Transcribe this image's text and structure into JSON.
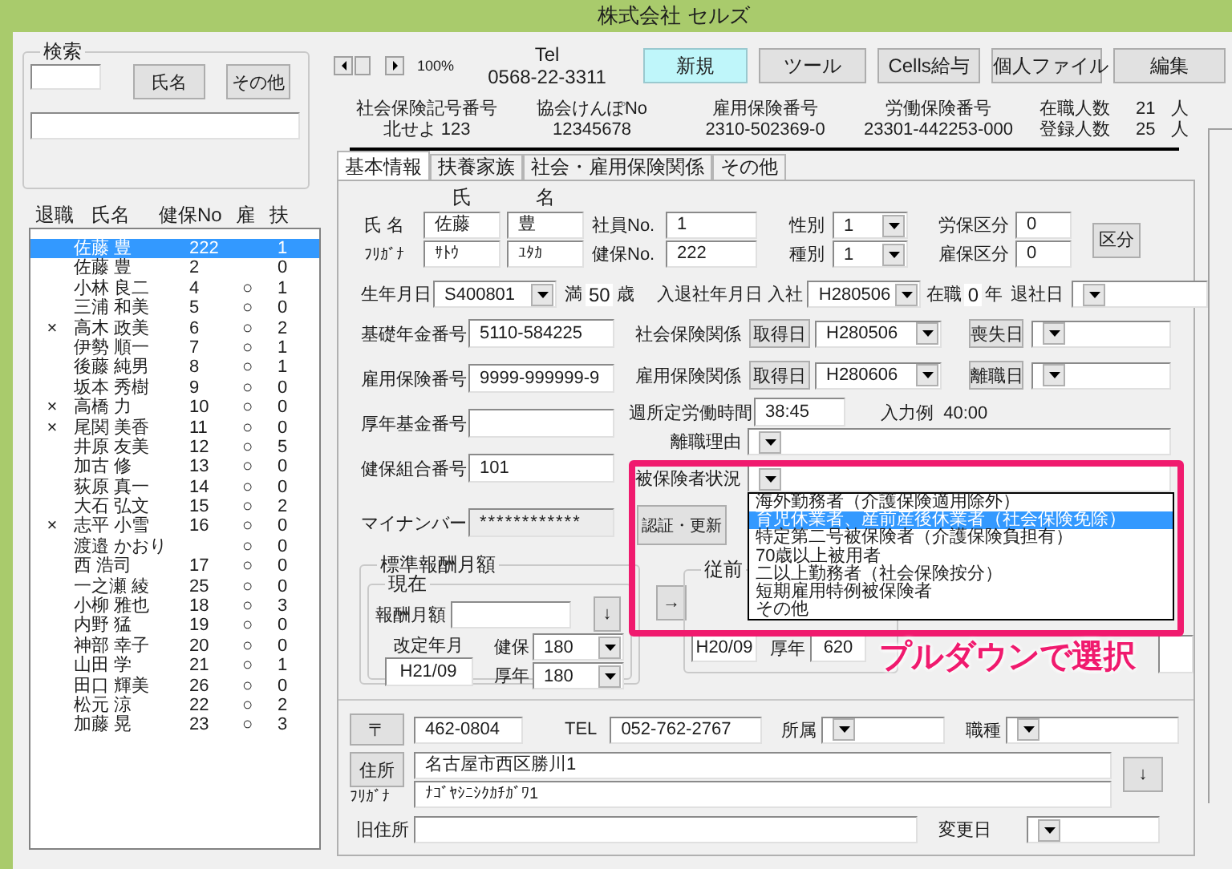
{
  "window": {
    "title": "株式会社 セルズ"
  },
  "search": {
    "title": "検索",
    "buttons": [
      "氏名",
      "その他"
    ]
  },
  "employee_list": {
    "columns": [
      "退職",
      "氏名",
      "健保No",
      "雇",
      "扶"
    ],
    "rows": [
      {
        "name": "佐藤 豊",
        "kenpo_no": "222",
        "dependents": "1",
        "selected": true
      },
      {
        "name": "佐藤 豊",
        "kenpo_no": "2",
        "dependents": "0",
        "selected": false
      },
      {
        "name": "小林 良二",
        "kenpo_no": "4",
        "employment": "○",
        "dependents": "1",
        "selected": false
      },
      {
        "name": "三浦 和美",
        "kenpo_no": "5",
        "employment": "○",
        "dependents": "0",
        "selected": false
      },
      {
        "retired": "×",
        "name": "高木 政美",
        "kenpo_no": "6",
        "employment": "○",
        "dependents": "2",
        "selected": false
      },
      {
        "name": "伊勢 順一",
        "kenpo_no": "7",
        "employment": "○",
        "dependents": "1",
        "selected": false
      },
      {
        "name": "後藤 純男",
        "kenpo_no": "8",
        "employment": "○",
        "dependents": "1",
        "selected": false
      },
      {
        "name": "坂本 秀樹",
        "kenpo_no": "9",
        "employment": "○",
        "dependents": "0",
        "selected": false
      },
      {
        "retired": "×",
        "name": "高橋 力",
        "kenpo_no": "10",
        "employment": "○",
        "dependents": "0",
        "selected": false
      },
      {
        "retired": "×",
        "name": "尾関 美香",
        "kenpo_no": "11",
        "employment": "○",
        "dependents": "0",
        "selected": false
      },
      {
        "name": "井原 友美",
        "kenpo_no": "12",
        "employment": "○",
        "dependents": "5",
        "selected": false
      },
      {
        "name": "加古 修",
        "kenpo_no": "13",
        "employment": "○",
        "dependents": "0",
        "selected": false
      },
      {
        "name": "荻原 真一",
        "kenpo_no": "14",
        "employment": "○",
        "dependents": "0",
        "selected": false
      },
      {
        "name": "大石 弘文",
        "kenpo_no": "15",
        "employment": "○",
        "dependents": "2",
        "selected": false
      },
      {
        "retired": "×",
        "name": "志平 小雪",
        "kenpo_no": "16",
        "employment": "○",
        "dependents": "0",
        "selected": false
      },
      {
        "name": "渡邉 かおり",
        "employment": "○",
        "dependents": "0",
        "selected": false
      },
      {
        "name": "西 浩司",
        "kenpo_no": "17",
        "employment": "○",
        "dependents": "0",
        "selected": false
      },
      {
        "name": "一之瀬 綾",
        "kenpo_no": "25",
        "employment": "○",
        "dependents": "0",
        "selected": false
      },
      {
        "name": "小柳 雅也",
        "kenpo_no": "18",
        "employment": "○",
        "dependents": "3",
        "selected": false
      },
      {
        "name": "内野 猛",
        "kenpo_no": "19",
        "employment": "○",
        "dependents": "0",
        "selected": false
      },
      {
        "name": "神部 幸子",
        "kenpo_no": "20",
        "employment": "○",
        "dependents": "0",
        "selected": false
      },
      {
        "name": "山田 学",
        "kenpo_no": "21",
        "employment": "○",
        "dependents": "1",
        "selected": false
      },
      {
        "name": "田口 輝美",
        "kenpo_no": "26",
        "employment": "○",
        "dependents": "0",
        "selected": false
      },
      {
        "name": "松元 涼",
        "kenpo_no": "22",
        "employment": "○",
        "dependents": "2",
        "selected": false
      },
      {
        "name": "加藤 晃",
        "kenpo_no": "23",
        "employment": "○",
        "dependents": "3",
        "selected": false
      }
    ]
  },
  "toolbar": {
    "zoom": "100%",
    "tel_label": "Tel",
    "tel": "0568-22-3311",
    "buttons": [
      {
        "label": "新規",
        "active": true
      },
      {
        "label": "ツール",
        "active": false
      },
      {
        "label": "Cells給与",
        "active": false
      },
      {
        "label": "個人ファイル",
        "active": false
      },
      {
        "label": "編集",
        "active": false
      }
    ]
  },
  "company_info": [
    {
      "label": "社会保険記号番号",
      "value": "北せよ 123"
    },
    {
      "label": "協会けんぽNo",
      "value": "12345678"
    },
    {
      "label": "雇用保険番号",
      "value": "2310-502369-0"
    },
    {
      "label": "労働保険番号",
      "value": "23301-442253-000"
    }
  ],
  "headcounts": [
    {
      "label": "在職人数",
      "value": "21",
      "unit": "人"
    },
    {
      "label": "登録人数",
      "value": "25",
      "unit": "人"
    }
  ],
  "tabs": [
    {
      "label": "基本情報",
      "selected": true
    },
    {
      "label": "扶養家族",
      "selected": false
    },
    {
      "label": "社会・雇用保険関係",
      "selected": false
    },
    {
      "label": "その他",
      "selected": false
    }
  ],
  "form": {
    "name_headers": [
      "氏",
      "名"
    ],
    "name": {
      "label": "氏 名",
      "last": "佐藤",
      "first": "豊"
    },
    "kana": {
      "label": "ﾌﾘｶﾞﾅ",
      "last": "ｻﾄｳ",
      "first": "ﾕﾀｶ"
    },
    "employee_no": {
      "label": "社員No.",
      "value": "1"
    },
    "kenpo_no": {
      "label": "健保No.",
      "value": "222"
    },
    "gender": {
      "label": "性別",
      "value": "1"
    },
    "category": {
      "label": "種別",
      "value": "1"
    },
    "labor_class": {
      "label": "労保区分",
      "value": "0"
    },
    "employment_class": {
      "label": "雇保区分",
      "value": "0"
    },
    "class_button": "区分",
    "birth": {
      "label": "生年月日",
      "value": "S400801",
      "age_prefix": "満",
      "age": "50",
      "age_suffix": "歳"
    },
    "hire": {
      "label": "入退社年月日 入社",
      "value": "H280506",
      "tenure_label": "在職",
      "tenure": "0",
      "tenure_unit": "年",
      "leave_label": "退社日"
    },
    "pension_no": {
      "label": "基礎年金番号",
      "value": "5110-584225"
    },
    "social": {
      "label": "社会保険関係",
      "acquire_button": "取得日",
      "acquire": "H280506",
      "loss_button": "喪失日"
    },
    "emp_ins_no": {
      "label": "雇用保険番号",
      "value": "9999-999999-9"
    },
    "emp_ins": {
      "label": "雇用保険関係",
      "acquire_button": "取得日",
      "acquire": "H280606",
      "loss_button": "離職日"
    },
    "weekly_hours": {
      "label": "週所定労働時間",
      "value": "38:45",
      "example": "入力例  40:00"
    },
    "fund_no": {
      "label": "厚年基金番号"
    },
    "leave_reason": {
      "label": "離職理由"
    },
    "union_no": {
      "label": "健保組合番号",
      "value": "101"
    },
    "insured_status": {
      "label": "被保険者状況",
      "options": [
        {
          "label": "海外勤務者（介護保険適用除外）",
          "selected": false
        },
        {
          "label": "育児休業者、産前産後休業者（社会保険免除）",
          "selected": true
        },
        {
          "label": "特定第二号被保険者（介護保険負担有）",
          "selected": false
        },
        {
          "label": "70歳以上被用者",
          "selected": false
        },
        {
          "label": "二以上勤務者（社会保険按分）",
          "selected": false
        },
        {
          "label": "短期雇用特例被保険者",
          "selected": false
        },
        {
          "label": "その他",
          "selected": false
        }
      ]
    },
    "my_number": {
      "label": "マイナンバー",
      "value": "************"
    },
    "auth_button": "認証・更新",
    "standard_pay": {
      "title": "標準報酬月額",
      "current": {
        "title": "現在",
        "pay_label": "報酬月額",
        "down_button": "↓",
        "revision_label": "改定年月",
        "revision": "H21/09",
        "health_label": "健保",
        "health": "180",
        "pension_label": "厚年",
        "pension": "180"
      },
      "copy_button": "→",
      "previous": {
        "title": "従前",
        "revision": "H20/09",
        "pension_label": "厚年",
        "pension": "620"
      }
    },
    "postal": {
      "button": "〒",
      "value": "462-0804"
    },
    "tel": {
      "label": "TEL",
      "value": "052-762-2767"
    },
    "affiliation": {
      "label": "所属"
    },
    "job": {
      "label": "職種"
    },
    "address": {
      "button": "住所",
      "value": "名古屋市西区勝川1",
      "kana_label": "ﾌﾘｶﾞﾅ",
      "kana": "ﾅｺﾞﾔｼﾆｼｸｶﾁｶﾞﾜ1",
      "down_button": "↓"
    },
    "old_address": {
      "label": "旧住所"
    },
    "change_date": {
      "label": "変更日"
    }
  },
  "annotation": {
    "caption": "プルダウンで選択"
  }
}
